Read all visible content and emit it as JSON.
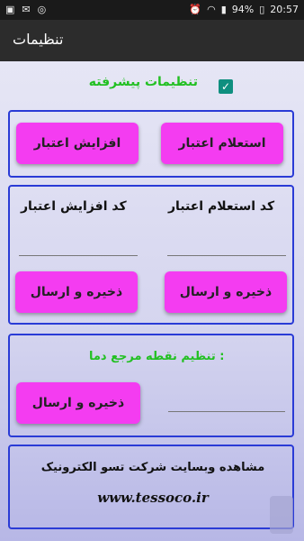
{
  "status": {
    "left_icons": [
      "image-icon",
      "mail-icon",
      "instagram-icon"
    ],
    "battery": "94%",
    "time": "20:57"
  },
  "appbar": {
    "title": "تنظیمات"
  },
  "advanced": {
    "label": "تنظیمات پیشرفته",
    "checked": true
  },
  "section1": {
    "inquiry_button": "استعلام اعتبار",
    "increase_button": "افزایش اعتبار"
  },
  "section2": {
    "inquiry_code_label": "کد استعلام اعتبار",
    "increase_code_label": "کد افزایش اعتبار",
    "save_send_right": "ذخیره و ارسال",
    "save_send_left": "ذخیره و ارسال"
  },
  "section3": {
    "label": "تنظیم نقطه مرجع دما :",
    "save_send": "ذخیره و ارسال"
  },
  "section4": {
    "visit_text": "مشاهده وبسایت شرکت تسو الکترونیک",
    "url": "www.tessoco.ir"
  },
  "colors": {
    "accent_button": "#f43cf1",
    "border": "#2a3bd6",
    "green_label": "#22c022",
    "appbar": "#2c2c2c"
  }
}
